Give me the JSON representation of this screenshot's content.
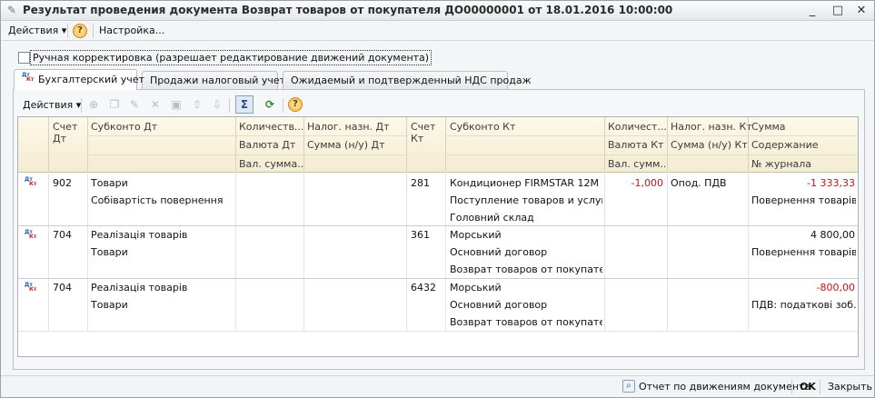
{
  "window": {
    "title": "Результат проведения документа Возврат товаров от покупателя ДО00000001 от 18.01.2016 10:00:00",
    "controls": {
      "minimize": "_",
      "maximize": "□",
      "close": "✕"
    }
  },
  "menubar": {
    "actions_label": "Действия",
    "help_label": "?",
    "settings_label": "Настройка..."
  },
  "manual_correction": {
    "label": "Ручная корректировка (разрешает редактирование движений документа)",
    "checked": false
  },
  "tabs": [
    {
      "label": "Бухгалтерский учет",
      "active": true
    },
    {
      "label": "Продажи налоговый учет",
      "active": false
    },
    {
      "label": "Ожидаемый и подтвержденный НДС продаж",
      "active": false
    }
  ],
  "table_toolbar": {
    "actions_label": "Действия",
    "dtkt_icon_text": {
      "dt": "Дт",
      "kt": "Кт"
    }
  },
  "columns": {
    "row1": [
      "Счет Дт",
      "Субконто Дт",
      "Количеств...",
      "Налог. назн. Дт",
      "Счет Кт",
      "Субконто Кт",
      "Количест...",
      "Налог. назн. Кт",
      "Сумма"
    ],
    "row2": [
      "Валюта Дт",
      "Сумма (н/у) Дт",
      "Валюта Кт",
      "Сумма (н/у) Кт",
      "Содержание"
    ],
    "row3": [
      "Вал. сумма...",
      "Вал. сумм...",
      "№ журнала"
    ],
    "schet_dt": [
      "Счет",
      "Дт"
    ],
    "schet_kt": [
      "Счет",
      "Кт"
    ]
  },
  "rows": [
    {
      "schet_dt": "902",
      "subkonto_dt": [
        "Товари",
        "Собівартість повернення",
        ""
      ],
      "schet_kt": "281",
      "subkonto_kt": [
        "Кондиционер FIRMSTAR 12M",
        "Поступление товаров и услуг ...",
        "Головний склад"
      ],
      "kol_kt": "-1,000",
      "nalog_kt": "Опод. ПДВ",
      "summa": "-1 333,33",
      "soderzhanie": "Повернення товарів ...",
      "negative": true
    },
    {
      "schet_dt": "704",
      "subkonto_dt": [
        "Реалізація товарів",
        "Товари",
        ""
      ],
      "schet_kt": "361",
      "subkonto_kt": [
        "Морський",
        "Основний договор",
        "Возврат товаров от покупател..."
      ],
      "kol_kt": "",
      "nalog_kt": "",
      "summa": "4 800,00",
      "soderzhanie": "Повернення товарів",
      "negative": false
    },
    {
      "schet_dt": "704",
      "subkonto_dt": [
        "Реалізація товарів",
        "Товари",
        ""
      ],
      "schet_kt": "6432",
      "subkonto_kt": [
        "Морський",
        "Основний договор",
        "Возврат товаров от покупател..."
      ],
      "kol_kt": "",
      "nalog_kt": "",
      "summa": "-800,00",
      "soderzhanie": "ПДВ: податкові зоб...",
      "negative": true
    }
  ],
  "footer": {
    "report_label": "Отчет по движениям документа",
    "ok_label": "OK",
    "close_label": "Закрыть"
  },
  "colors": {
    "header_bg": "#f4ecd2",
    "negative": "#c0141b",
    "dt_icon": "#1b5fc2",
    "kt_icon": "#d02020"
  }
}
